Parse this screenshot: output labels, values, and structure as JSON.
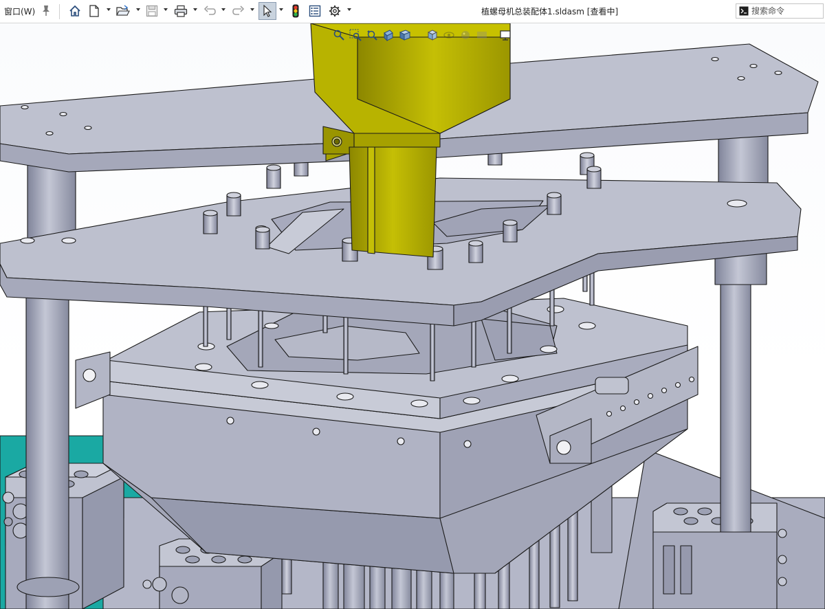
{
  "menu": {
    "window_label": "窗口(W)"
  },
  "toolbar": {
    "buttons": [
      {
        "name": "home-icon"
      },
      {
        "name": "new-document-icon"
      },
      {
        "name": "open-folder-icon"
      },
      {
        "name": "save-icon"
      },
      {
        "name": "print-icon"
      },
      {
        "name": "undo-icon"
      },
      {
        "name": "redo-icon"
      },
      {
        "name": "select-cursor-icon"
      },
      {
        "name": "rebuild-traffic-light-icon"
      },
      {
        "name": "file-properties-icon"
      },
      {
        "name": "options-gear-icon"
      }
    ]
  },
  "document": {
    "title": "植螺母机总装配体1.sldasm [查看中]"
  },
  "search": {
    "placeholder": "搜索命令"
  },
  "heads_up_toolbar": {
    "icons": [
      "zoom-to-fit-icon",
      "zoom-area-icon",
      "previous-view-icon",
      "section-view-icon",
      "view-orientation-icon",
      "display-style-icon",
      "hide-show-icon",
      "edit-appearance-icon",
      "apply-scene-icon",
      "view-settings-icon"
    ]
  },
  "colors": {
    "part_gray": "#b3b6c7",
    "part_gray_dark": "#8e91a4",
    "part_gray_light": "#c7c9d6",
    "cylinder_yellow": "#b5b000",
    "base_teal": "#18a9a3",
    "edge": "#1a1a1a",
    "select_highlight": "#c9d3de"
  }
}
